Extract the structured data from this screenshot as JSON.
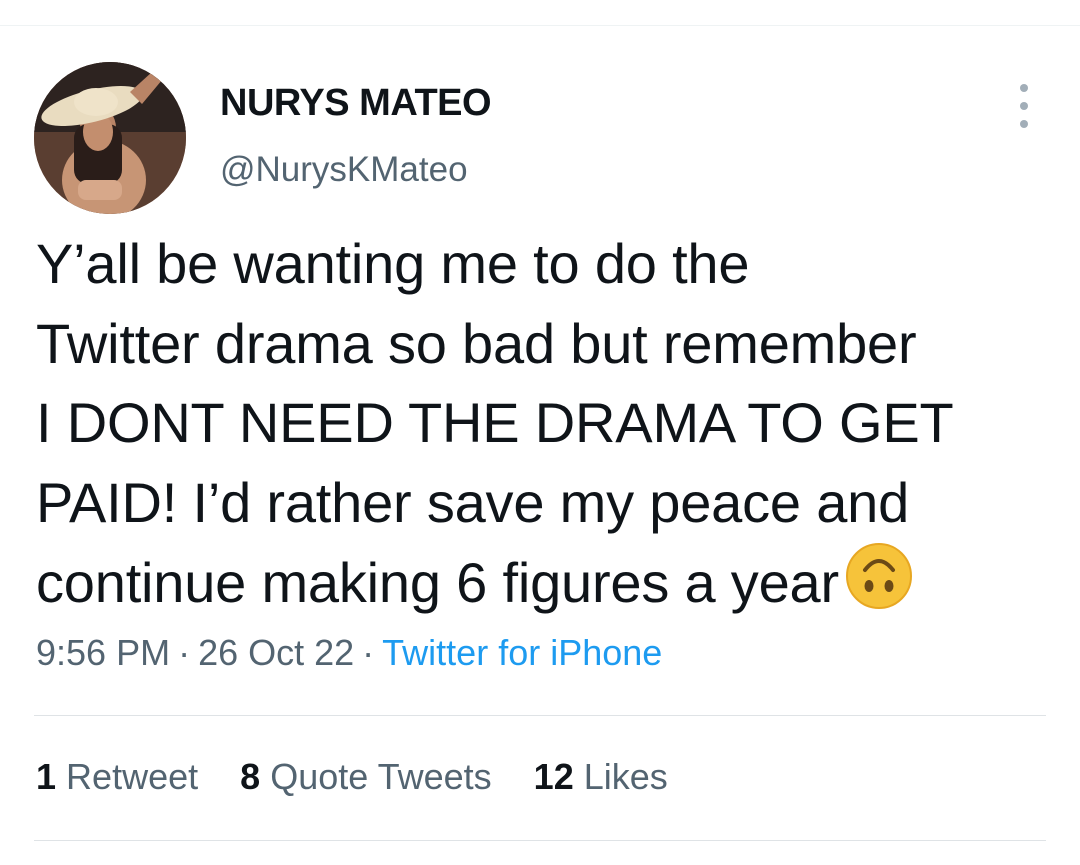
{
  "author": {
    "name": "NURYS MATEO",
    "handle": "@NurysKMateo"
  },
  "tweet": {
    "lines": [
      "Y’all be wanting me to do the",
      "Twitter drama so bad but remember",
      "I DONT NEED THE DRAMA TO GET",
      "PAID! I’d rather save my peace and",
      "continue making 6 figures a year"
    ],
    "emoji": "upside-down-face-icon"
  },
  "meta": {
    "time": "9:56 PM",
    "separator": "·",
    "date": "26 Oct 22",
    "source": "Twitter for iPhone"
  },
  "stats": {
    "retweets_count": "1",
    "retweets_label": "Retweet",
    "quotes_count": "8",
    "quotes_label": "Quote Tweets",
    "likes_count": "12",
    "likes_label": "Likes"
  },
  "colors": {
    "text": "#0f1419",
    "secondary": "#536471",
    "link": "#1d9bf0",
    "divider": "#dfe3e6"
  }
}
